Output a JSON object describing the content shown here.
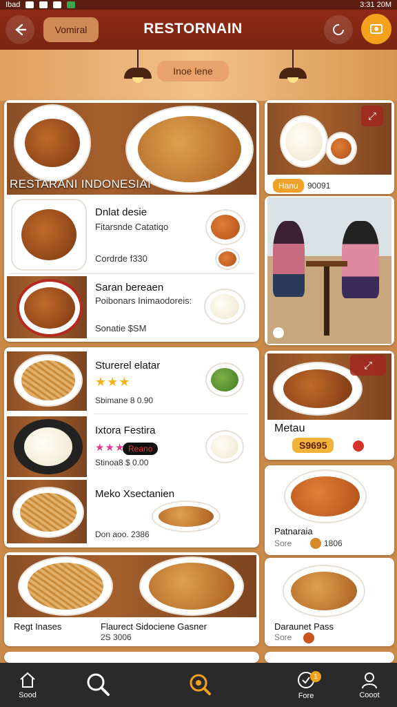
{
  "status_bar": {
    "carrier": "Ibad",
    "time": "3:31 20M"
  },
  "app_bar": {
    "location_chip": "Vomiral",
    "title": "RESTORNAIN"
  },
  "hero": {
    "chip": "Inoe lene"
  },
  "featured": {
    "title": "RESTARANI INDONESIAI",
    "items": [
      {
        "name": "Dnlat desie",
        "subtitle": "Fitarsnde Catatiqo",
        "price": "Cordrde f330"
      },
      {
        "name": "Saran bereaen",
        "subtitle": "Poibonars Inimaodoreis:",
        "price": "Sonatie $SM"
      }
    ]
  },
  "list": {
    "items": [
      {
        "name": "Sturerel elatar",
        "rating": "★★★",
        "price": "Sbimane 8 0.90"
      },
      {
        "name": "Ixtora Festira",
        "rating": "★★★",
        "badge": "Reano",
        "price": "Stinoa8 $ 0.00"
      },
      {
        "name": "Meko Xsectanien",
        "price": "Don aoo. 2386"
      }
    ]
  },
  "bottom_row": {
    "left_label": "Regt Inases",
    "right_label": "Flaurect Sidociene Gasner",
    "price": "2S 3006"
  },
  "right_column": {
    "card1": {
      "badge": "Hanu",
      "price": "90091"
    },
    "card3": {
      "name": "Metau",
      "badge": "S9695"
    },
    "card4": {
      "name": "Patnaraia",
      "sub": "Sore",
      "price": "1806"
    },
    "card5": {
      "name": "Daraunet Pass",
      "sub": "Sore"
    }
  },
  "bottom_nav": [
    {
      "label": "Sood",
      "icon": "home-icon"
    },
    {
      "label": "",
      "icon": "search-icon"
    },
    {
      "label": "",
      "icon": "discover-icon"
    },
    {
      "label": "Fore",
      "icon": "orders-icon",
      "badge": "1"
    },
    {
      "label": "Cooot",
      "icon": "profile-icon"
    }
  ],
  "colors": {
    "appbar": "#7a2412",
    "accent": "#f4a21c",
    "navbar": "#2a2a2a"
  }
}
